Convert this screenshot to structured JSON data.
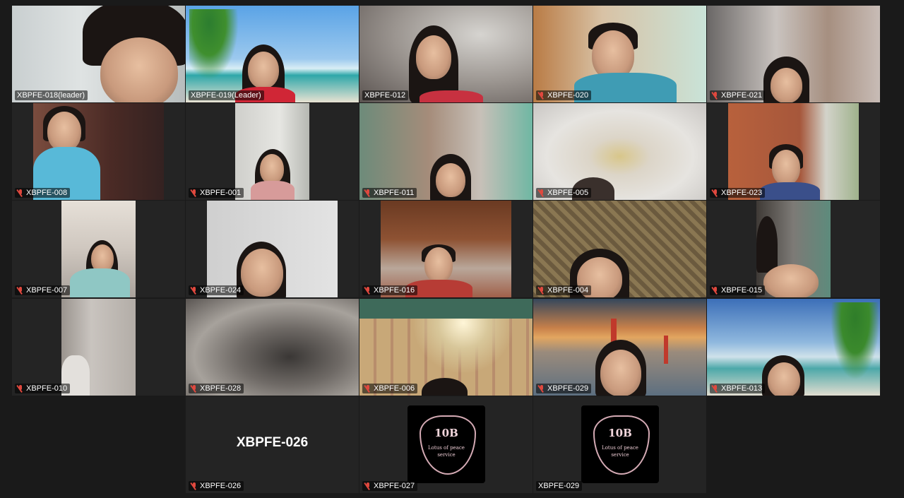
{
  "participants": [
    {
      "label": "XBPFE-018(leader)",
      "muted": false
    },
    {
      "label": "XBPFE-019(Leader)",
      "muted": false
    },
    {
      "label": "XBPFE-012",
      "muted": false,
      "speaking": true
    },
    {
      "label": "XBPFE-020",
      "muted": true
    },
    {
      "label": "XBPFE-021",
      "muted": true
    },
    {
      "label": "XBPFE-008",
      "muted": true
    },
    {
      "label": "XBPFE-001",
      "muted": true
    },
    {
      "label": "XBPFE-011",
      "muted": true
    },
    {
      "label": "XBPFE-005",
      "muted": true
    },
    {
      "label": "XBPFE-023",
      "muted": true
    },
    {
      "label": "XBPFE-007",
      "muted": true
    },
    {
      "label": "XBPFE-024",
      "muted": true
    },
    {
      "label": "XBPFE-016",
      "muted": true
    },
    {
      "label": "XBPFE-004",
      "muted": true
    },
    {
      "label": "XBPFE-015",
      "muted": true
    },
    {
      "label": "XBPFE-010",
      "muted": true
    },
    {
      "label": "XBPFE-028",
      "muted": true
    },
    {
      "label": "XBPFE-006",
      "muted": true
    },
    {
      "label": "XBPFE-029",
      "muted": true
    },
    {
      "label": "XBPFE-013",
      "muted": true
    },
    {
      "label": "XBPFE-026",
      "muted": true,
      "video_off": true,
      "display_name": "XBPFE-026"
    },
    {
      "label": "XBPFE-027",
      "muted": true,
      "video_off": true,
      "logo": {
        "title": "10B",
        "subtitle": "Lotus of peace",
        "subtitle2": "service"
      }
    },
    {
      "label": "XBPFE-029",
      "muted": false,
      "video_off": true,
      "logo": {
        "title": "10B",
        "subtitle": "Lotus of peace",
        "subtitle2": "service"
      }
    }
  ],
  "colors": {
    "speaker_border": "#3fd17a",
    "muted_icon": "#e0483e",
    "tile_bg": "#242424"
  }
}
